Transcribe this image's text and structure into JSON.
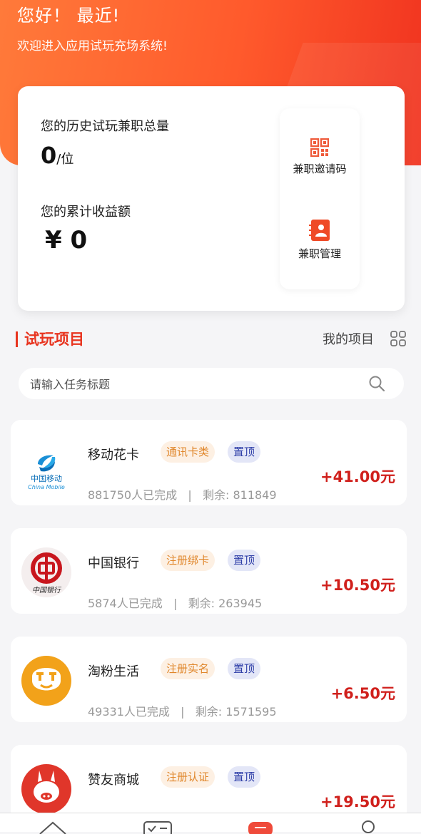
{
  "header": {
    "greeting": "您好！ 最近!",
    "welcome": "欢迎进入应用试玩充场系统!"
  },
  "stats": {
    "history_label": "您的历史试玩兼职总量",
    "history_value": "0",
    "history_unit": "/位",
    "income_label": "您的累计收益额",
    "income_value": "¥ 0"
  },
  "quick_actions": {
    "invite_label": "兼职邀请码",
    "manage_label": "兼职管理"
  },
  "section": {
    "title": "试玩项目",
    "my_projects": "我的项目"
  },
  "search": {
    "placeholder": "请输入任务标题"
  },
  "tasks": [
    {
      "name": "移动花卡",
      "category": "通讯卡类",
      "pin": "置顶",
      "meta": "881750人已完成   |   剩余: 811849",
      "price": "+41.00元",
      "logo_text_cn": "中国移动",
      "logo_text_en": "China Mobile"
    },
    {
      "name": "中国银行",
      "category": "注册绑卡",
      "pin": "置顶",
      "meta": "5874人已完成   |   剩余: 263945",
      "price": "+10.50元",
      "logo_text_cn": "中国银行"
    },
    {
      "name": "淘粉生活",
      "category": "注册实名",
      "pin": "置顶",
      "meta": "49331人已完成   |   剩余: 1571595",
      "price": "+6.50元"
    },
    {
      "name": "赞友商城",
      "category": "注册认证",
      "pin": "置顶",
      "meta": "",
      "price": "+19.50元"
    }
  ],
  "colors": {
    "accent": "#e8341f",
    "price": "#d0201c",
    "tag_category_bg": "#fdf0e3",
    "tag_category_text": "#e0862a",
    "tag_pin_bg": "#e3e6f7",
    "tag_pin_text": "#2f3fa8"
  },
  "icons": {
    "invite": "qr-code-icon",
    "manage": "id-card-icon",
    "grid": "grid-icon",
    "search": "search-icon"
  }
}
